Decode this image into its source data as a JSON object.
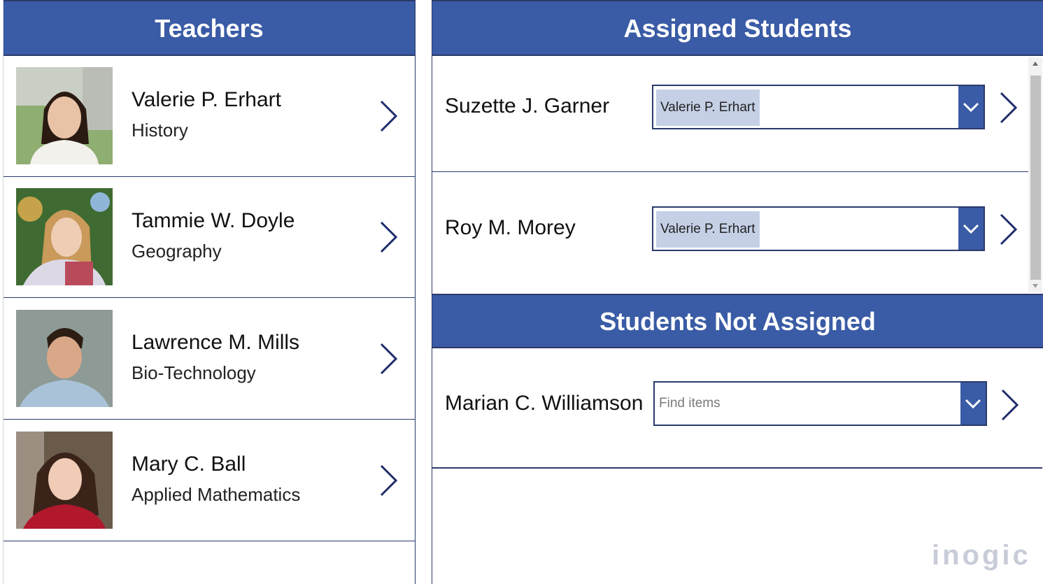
{
  "teachers_panel": {
    "title": "Teachers",
    "items": [
      {
        "name": "Valerie P. Erhart",
        "subject": "History"
      },
      {
        "name": "Tammie W. Doyle",
        "subject": "Geography"
      },
      {
        "name": "Lawrence M. Mills",
        "subject": "Bio-Technology"
      },
      {
        "name": "Mary C. Ball",
        "subject": "Applied Mathematics"
      }
    ]
  },
  "assigned_panel": {
    "title": "Assigned Students",
    "items": [
      {
        "name": "Suzette J. Garner",
        "teacher": "Valerie P. Erhart"
      },
      {
        "name": "Roy M. Morey",
        "teacher": "Valerie P. Erhart"
      }
    ]
  },
  "unassigned_panel": {
    "title": "Students Not Assigned",
    "items": [
      {
        "name": "Marian C. Williamson",
        "placeholder": "Find items"
      }
    ]
  },
  "branding": {
    "logo_text": "inogic"
  },
  "colors": {
    "accent": "#3a5ba5",
    "border": "#2b3a6b",
    "tag": "#c5d0e6"
  },
  "icons": {
    "row_nav": "chevron-right-icon",
    "dropdown": "chevron-down-icon"
  }
}
